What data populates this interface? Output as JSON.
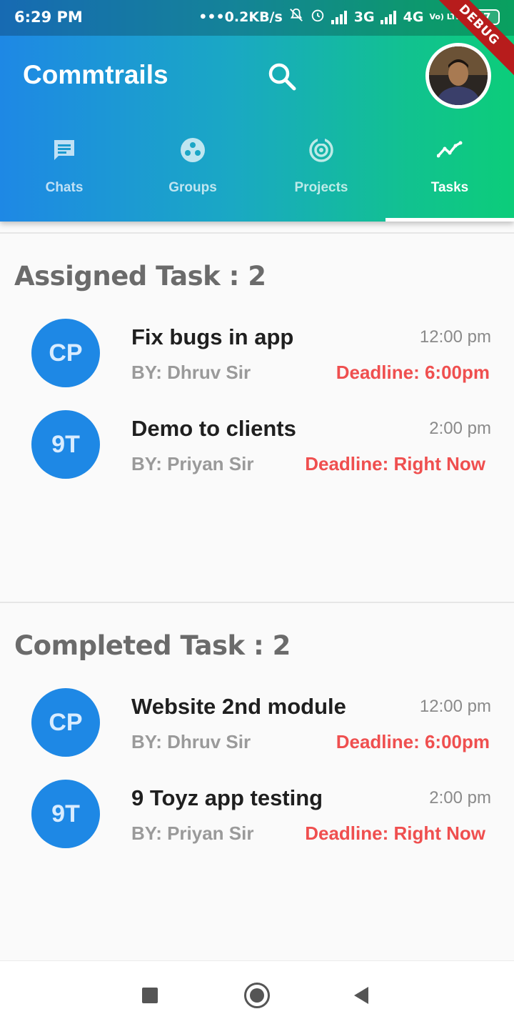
{
  "status_bar": {
    "time": "6:29 PM",
    "network_speed": "•••0.2KB/s",
    "sim1": "3G",
    "sim2": "4G",
    "volte": "Vo) LTE",
    "battery": "27"
  },
  "debug_banner": "DEBUG",
  "app_bar": {
    "title": "Commtrails",
    "search_icon": "search-icon",
    "avatar": "profile-avatar"
  },
  "tabs": [
    {
      "label": "Chats",
      "icon": "chat-icon",
      "active": false
    },
    {
      "label": "Groups",
      "icon": "groups-icon",
      "active": false
    },
    {
      "label": "Projects",
      "icon": "projects-icon",
      "active": false
    },
    {
      "label": "Tasks",
      "icon": "trending-icon",
      "active": true
    }
  ],
  "assigned": {
    "title": "Assigned Task : 2",
    "tasks": [
      {
        "initials": "CP",
        "name": "Fix bugs in app",
        "time": "12:00 pm",
        "by": "BY: Dhruv Sir",
        "deadline": "Deadline: 6:00pm"
      },
      {
        "initials": "9T",
        "name": "Demo to clients",
        "time": "2:00 pm",
        "by": "BY: Priyan Sir",
        "deadline": "Deadline: Right Now"
      }
    ]
  },
  "completed": {
    "title": "Completed Task : 2",
    "tasks": [
      {
        "initials": "CP",
        "name": "Website 2nd module",
        "time": "12:00 pm",
        "by": "BY: Dhruv Sir",
        "deadline": "Deadline: 6:00pm"
      },
      {
        "initials": "9T",
        "name": "9 Toyz app testing",
        "time": "2:00 pm",
        "by": "BY: Priyan Sir",
        "deadline": "Deadline: Right Now"
      }
    ]
  },
  "colors": {
    "accent": "#1e88e5",
    "gradient_end": "#0ccd7a",
    "deadline": "#ef4f4f"
  },
  "nav_bar": {
    "recent": "recent-apps-icon",
    "home": "home-icon",
    "back": "back-icon"
  }
}
